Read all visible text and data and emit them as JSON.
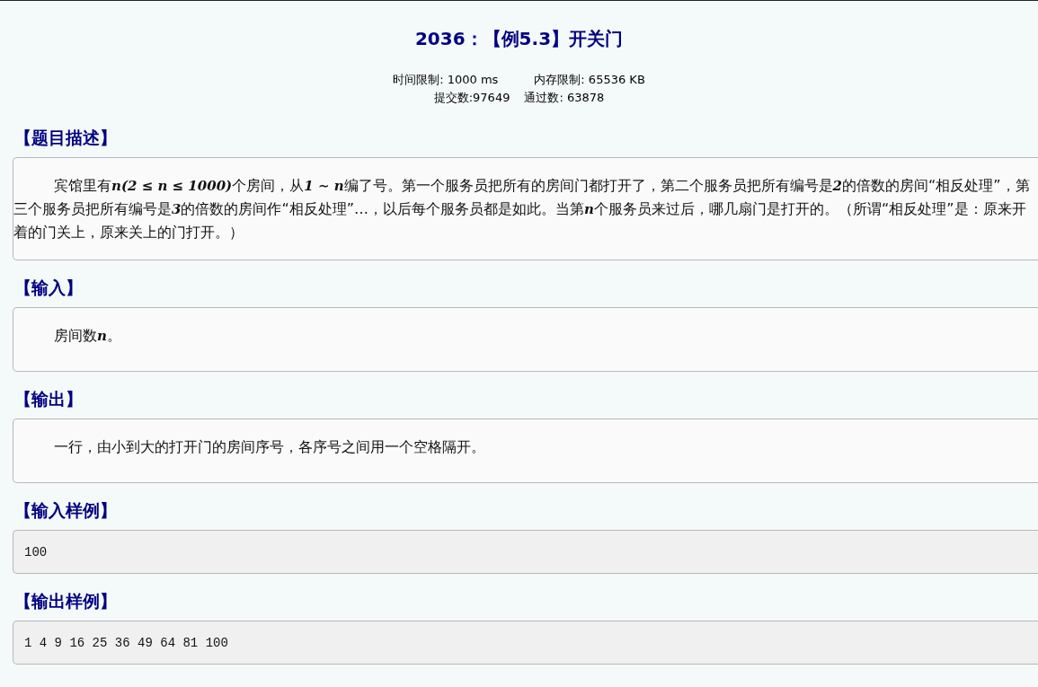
{
  "problem": {
    "title": "2036：【例5.3】开关门",
    "time_limit": "时间限制: 1000 ms",
    "memory_limit": "内存限制: 65536 KB",
    "submissions": "提交数:97649",
    "accepted": "通过数: 63878"
  },
  "sections": [
    {
      "kind": "text",
      "heading": "【题目描述】",
      "body": [
        {
          "kind": "text",
          "text": "宾馆里有"
        },
        {
          "kind": "math",
          "text": "n(2 ≤ n ≤ 1000)"
        },
        {
          "kind": "text",
          "text": "个房间，从"
        },
        {
          "kind": "math",
          "text": "1 ∼ n"
        },
        {
          "kind": "text",
          "text": "编了号。第一个服务员把所有的房间门都打开了，第二个服务员把所有编号是"
        },
        {
          "kind": "math",
          "text": "2"
        },
        {
          "kind": "text",
          "text": "的倍数的房间“相反处理”，第三个服务员把所有编号是"
        },
        {
          "kind": "math",
          "text": "3"
        },
        {
          "kind": "text",
          "text": "的倍数的房间作“相反处理”…，以后每个服务员都是如此。当第"
        },
        {
          "kind": "math",
          "text": "n"
        },
        {
          "kind": "text",
          "text": "个服务员来过后，哪几扇门是打开的。（所谓“相反处理”是：原来开着的门关上，原来关上的门打开。）"
        }
      ]
    },
    {
      "kind": "text",
      "heading": "【输入】",
      "body": [
        {
          "kind": "text",
          "text": "房间数"
        },
        {
          "kind": "math",
          "text": "n"
        },
        {
          "kind": "text",
          "text": "。"
        }
      ]
    },
    {
      "kind": "text",
      "heading": "【输出】",
      "body": [
        {
          "kind": "text",
          "text": "一行，由小到大的打开门的房间序号，各序号之间用一个空格隔开。"
        }
      ]
    },
    {
      "kind": "code",
      "heading": "【输入样例】",
      "body": "100"
    },
    {
      "kind": "code",
      "heading": "【输出样例】",
      "body": "1 4 9 16 25 36 49 64 81 100"
    }
  ]
}
